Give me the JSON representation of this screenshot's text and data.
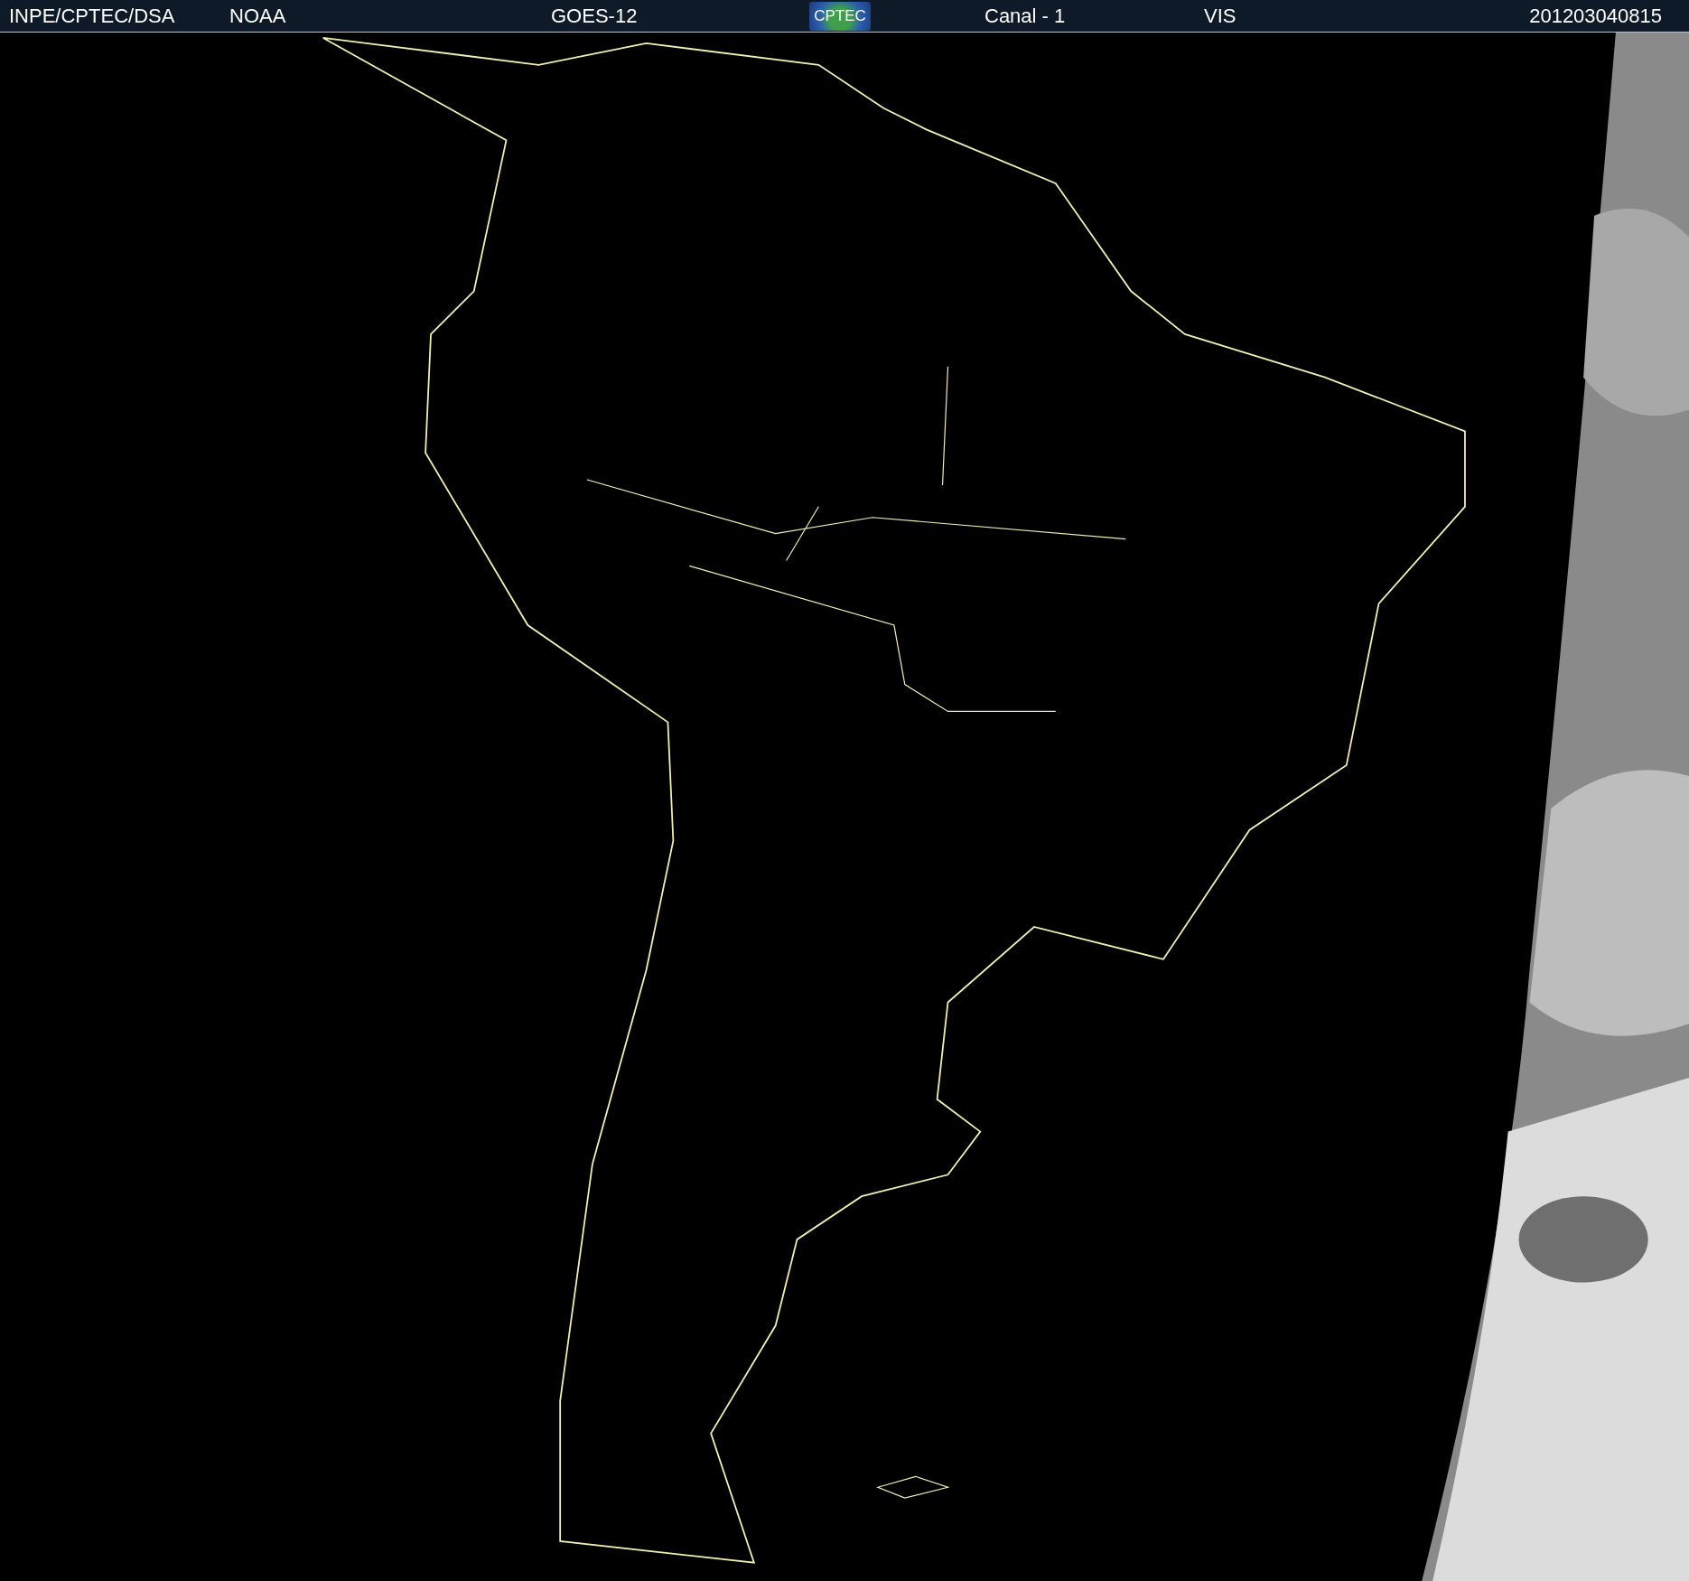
{
  "header": {
    "items": [
      {
        "kind": "text",
        "text": "INPE/CPTEC/DSA"
      },
      {
        "kind": "text",
        "text": "NOAA"
      },
      {
        "kind": "text",
        "text": "GOES-12"
      },
      {
        "kind": "logo",
        "text": "CPTEC"
      },
      {
        "kind": "text",
        "text": "Canal - 1"
      },
      {
        "kind": "text",
        "text": "VIS"
      },
      {
        "kind": "text",
        "text": "201203040815"
      }
    ]
  }
}
